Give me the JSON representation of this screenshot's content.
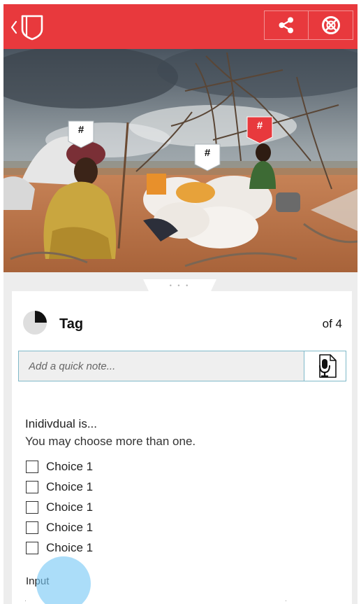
{
  "header": {
    "back_icon": "back-document-icon",
    "share_icon": "share-icon",
    "close_icon": "close-circle-icon",
    "background": "#e8393d"
  },
  "photo": {
    "tags": [
      {
        "label": "#",
        "state": "default"
      },
      {
        "label": "#",
        "state": "default"
      },
      {
        "label": "#",
        "state": "active"
      }
    ]
  },
  "panel": {
    "handle_dots": "• • •",
    "progress": {
      "completed": 1,
      "total": 4
    },
    "title": "Tag",
    "count": "of 4",
    "note": {
      "value": "",
      "placeholder": "Add a quick note...",
      "mic_icon": "microphone-icon"
    },
    "question": "Inidivdual is...",
    "helper": "You may choose more than one.",
    "choices": [
      {
        "label": "Choice 1",
        "checked": false
      },
      {
        "label": "Choice 1",
        "checked": false
      },
      {
        "label": "Choice 1",
        "checked": false
      },
      {
        "label": "Choice 1",
        "checked": false
      },
      {
        "label": "Choice 1",
        "checked": false
      }
    ],
    "input_label": "Input"
  },
  "colors": {
    "accent_red": "#e8393d",
    "field_border": "#7fb9c9",
    "panel_background": "#ededed",
    "touch_indicator": "#78c8f5"
  }
}
